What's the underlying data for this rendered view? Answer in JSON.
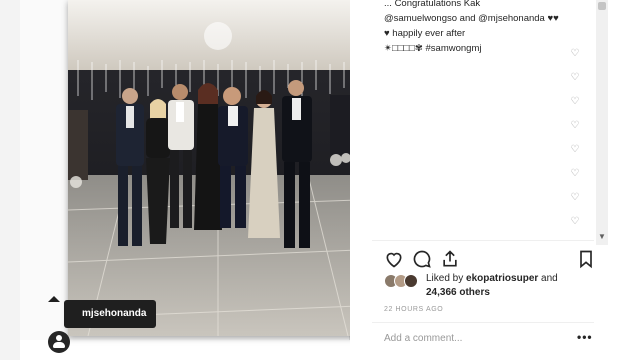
{
  "caption": {
    "line1": "Congratulations Kak",
    "line1_prefix": "...",
    "line2_user1": "@samuelwongso",
    "line2_mid": " and ",
    "line2_user2": "@mjsehonanda",
    "line2_suffix": " ♥♥",
    "line3": "♥ happily ever after",
    "line4": "✴□□□□✾ #samwongmj"
  },
  "comment_hearts": [
    "♡",
    "♡",
    "♡",
    "♡",
    "♡",
    "♡",
    "♡",
    "♡"
  ],
  "photo": {
    "tag_label": "mjsehonanda"
  },
  "actions": {
    "like_icon": "heart-outline-icon",
    "comment_icon": "comment-bubble-icon",
    "share_icon": "share-upload-icon",
    "save_icon": "bookmark-icon"
  },
  "likes": {
    "prefix": "Liked by ",
    "user": "ekopatriosuper",
    "mid": " and",
    "count": "24,366 others"
  },
  "timestamp": "22 HOURS AGO",
  "comment_placeholder": "Add a comment...",
  "more_label": "•••",
  "colors": {
    "text": "#262626",
    "muted": "#9a9a9a",
    "tag_bg": "#1f1f1f"
  }
}
